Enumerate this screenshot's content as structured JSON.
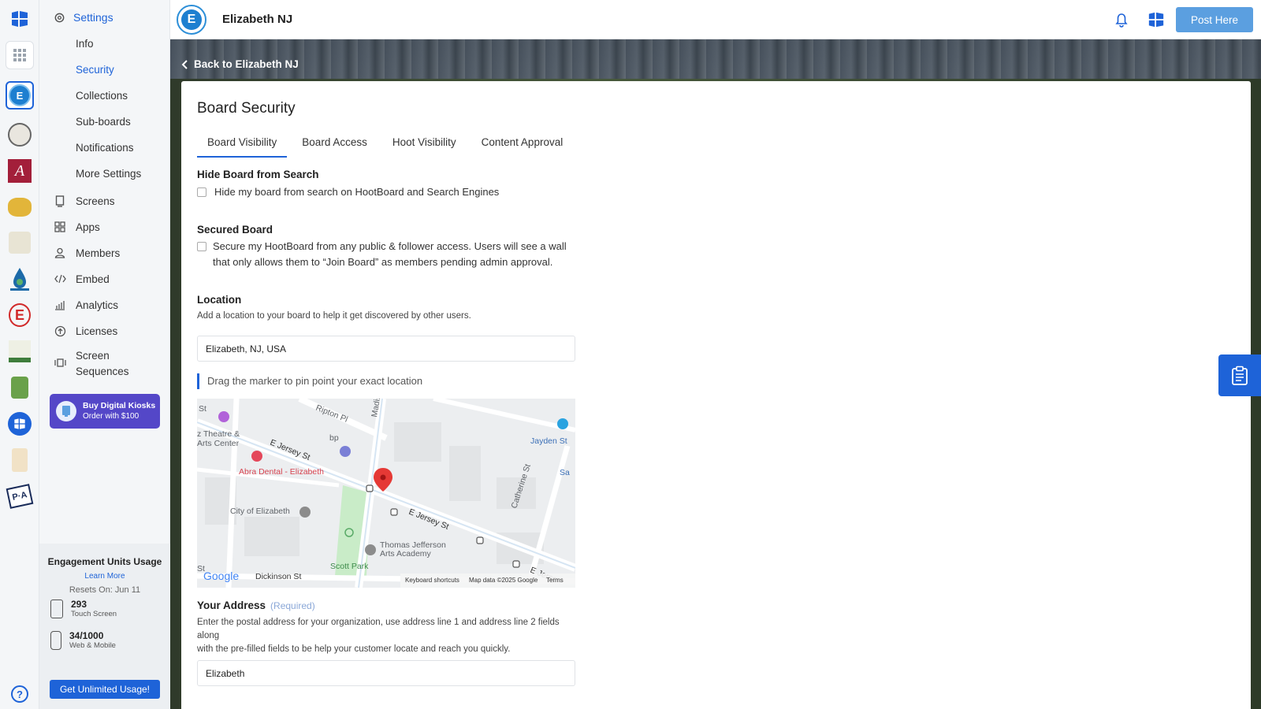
{
  "sidebar": {
    "heading": "Settings",
    "sub_items": [
      {
        "label": "Info"
      },
      {
        "label": "Security"
      },
      {
        "label": "Collections"
      },
      {
        "label": "Sub-boards"
      },
      {
        "label": "Notifications"
      },
      {
        "label": "More Settings"
      }
    ],
    "items": [
      {
        "label": "Screens",
        "icon": "screen-icon"
      },
      {
        "label": "Apps",
        "icon": "apps-icon"
      },
      {
        "label": "Members",
        "icon": "members-icon"
      },
      {
        "label": "Embed",
        "icon": "embed-icon"
      },
      {
        "label": "Analytics",
        "icon": "analytics-icon"
      },
      {
        "label": "Licenses",
        "icon": "licenses-icon"
      },
      {
        "label": "Screen Sequences",
        "icon": "sequences-icon"
      }
    ],
    "promo": {
      "title": "Buy Digital Kiosks",
      "subtitle": "Order with $100"
    },
    "usage": {
      "title": "Engagement Units Usage",
      "learn_more": "Learn More",
      "resets": "Resets On: Jun 11",
      "touch": {
        "value": "293",
        "caption": "Touch Screen"
      },
      "web": {
        "value": "34/1000",
        "caption": "Web & Mobile"
      },
      "cta": "Get Unlimited Usage!"
    }
  },
  "header": {
    "board_name": "Elizabeth NJ",
    "post_button": "Post Here"
  },
  "banner": {
    "back_link": "Back to Elizabeth NJ"
  },
  "main": {
    "title": "Board Security",
    "tabs": [
      {
        "label": "Board Visibility",
        "active": true
      },
      {
        "label": "Board Access"
      },
      {
        "label": "Hoot Visibility"
      },
      {
        "label": "Content Approval"
      }
    ],
    "hide_search": {
      "title": "Hide Board from Search",
      "checkbox_label": "Hide my board from search on HootBoard and Search Engines",
      "checked": false
    },
    "secured": {
      "title": "Secured Board",
      "checkbox_label_line1": "Secure my HootBoard from any public & follower access. Users will see a wall",
      "checkbox_label_line2": "that only allows them to “Join Board” as members pending admin approval.",
      "checked": false
    },
    "location": {
      "title": "Location",
      "helper": "Add a location to your board to help it get discovered by other users.",
      "value": "Elizabeth, NJ, USA",
      "hint": "Drag the marker to pin point your exact location"
    },
    "map": {
      "labels": {
        "pl": "Ripton Pl",
        "madison": "Madis",
        "st_left": "St",
        "theatre1": "z Theatre &",
        "theatre2": "Arts Center",
        "jersey_w": "E Jersey St",
        "bp": "bp",
        "jayden": "Jayden St",
        "sa": "Sa",
        "catherine": "Catherine St",
        "abra": "Abra Dental - Elizabeth",
        "city": "City of Elizabeth",
        "jersey_e": "E Jersey St",
        "tj1": "Thomas Jefferson",
        "tj2": "Arts Academy",
        "scott": "Scott Park",
        "dickinson": "Dickinson St",
        "st_bottom": "St",
        "jerse": "E Jerse",
        "google": "Google",
        "shortcuts": "Keyboard shortcuts",
        "mapdata": "Map data ©2025 Google",
        "terms": "Terms"
      }
    },
    "address": {
      "title": "Your Address",
      "required": "(Required)",
      "helper_line1": "Enter the postal address for your organization, use address line 1 and address line 2 fields",
      "helper_line2": "along",
      "helper_line3": "with the pre-filled fields to be help your customer locate and reach you quickly.",
      "value": "Elizabeth"
    }
  },
  "colors": {
    "accent": "#1e63d8",
    "post_button": "#5b9fe0",
    "promo": "#5447c8"
  }
}
